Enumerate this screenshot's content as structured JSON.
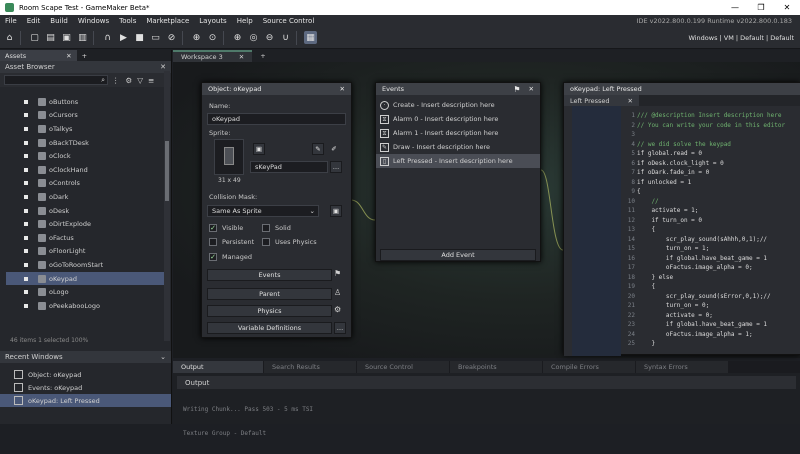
{
  "window": {
    "title": "Room Scape Test - GameMaker Beta*",
    "controls": [
      "—",
      "❐",
      "✕"
    ]
  },
  "menu": {
    "items": [
      "File",
      "Edit",
      "Build",
      "Windows",
      "Tools",
      "Marketplace",
      "Layouts",
      "Help",
      "Source Control"
    ],
    "version": "IDE v2022.800.0.199 Runtime v2022.800.0.183"
  },
  "toolbar": {
    "right": "Windows | VM | Default | Default"
  },
  "assets": {
    "tab": "Assets",
    "tab2": "+",
    "header": "Asset Browser",
    "items": [
      "oButtons",
      "oCursors",
      "oTalkys",
      "oBackTDesk",
      "oClock",
      "oClockHand",
      "oControls",
      "oDark",
      "oDesk",
      "oDirtExplode",
      "oFactus",
      "oFloorLight",
      "oGoToRoomStart",
      "oKeypad",
      "oLogo",
      "oPeekabooLogo"
    ],
    "selected": 13,
    "status": "46 items  1 selected  100%"
  },
  "recent": {
    "header": "Recent Windows",
    "items": [
      "Object: oKeypad",
      "Events: oKeypad",
      "oKeypad: Left Pressed"
    ]
  },
  "workspace": {
    "tab": "Workspace 3"
  },
  "object": {
    "title": "Object: oKeypad",
    "name_label": "Name:",
    "name_value": "oKeypad",
    "sprite_label": "Sprite:",
    "sprite_name": "sKeyPad",
    "sprite_size": "31 x 49",
    "mask_label": "Collision Mask:",
    "mask_value": "Same As Sprite",
    "visible": "Visible",
    "solid": "Solid",
    "persistent": "Persistent",
    "uses_physics": "Uses Physics",
    "managed": "Managed",
    "btn_events": "Events",
    "btn_parent": "Parent",
    "btn_physics": "Physics",
    "btn_vardefs": "Variable Definitions"
  },
  "events": {
    "title": "Events",
    "items": [
      "Create - Insert description here",
      "Alarm 0 - Insert description here",
      "Alarm 1 - Insert description here",
      "Draw - Insert description here",
      "Left Pressed - Insert description here"
    ],
    "selected": 4,
    "add": "Add Event"
  },
  "code": {
    "title": "oKeypad: Left Pressed",
    "tab": "Left Pressed",
    "lines": [
      {
        "n": "1",
        "t": "/// @description Insert description here",
        "c": "#6fb36f"
      },
      {
        "n": "2",
        "t": "// You can write your code in this editor",
        "c": "#6fb36f"
      },
      {
        "n": "3",
        "t": "",
        "c": "#ddd"
      },
      {
        "n": "4",
        "t": "// we did solve the keypad",
        "c": "#6fb36f"
      },
      {
        "n": "5",
        "t": "if global.read = 0",
        "c": "#ddd"
      },
      {
        "n": "6",
        "t": "if oDesk.clock_light = 0",
        "c": "#ddd"
      },
      {
        "n": "7",
        "t": "if oDark.fade_in = 0",
        "c": "#ddd"
      },
      {
        "n": "8",
        "t": "if unlocked = 1",
        "c": "#ddd"
      },
      {
        "n": "9",
        "t": "{",
        "c": "#ddd"
      },
      {
        "n": "10",
        "t": "    //",
        "c": "#6fb36f"
      },
      {
        "n": "11",
        "t": "    activate = 1;",
        "c": "#ddd"
      },
      {
        "n": "12",
        "t": "    if turn_on = 0",
        "c": "#ddd"
      },
      {
        "n": "13",
        "t": "    {",
        "c": "#ddd"
      },
      {
        "n": "14",
        "t": "        scr_play_sound(sAhhh,0,1);//",
        "c": "#ddd"
      },
      {
        "n": "15",
        "t": "        turn_on = 1;",
        "c": "#ddd"
      },
      {
        "n": "16",
        "t": "        if global.have_beat_game = 1",
        "c": "#ddd"
      },
      {
        "n": "17",
        "t": "        oFactus.image_alpha = 0;",
        "c": "#ddd"
      },
      {
        "n": "18",
        "t": "    } else",
        "c": "#ddd"
      },
      {
        "n": "19",
        "t": "    {",
        "c": "#ddd"
      },
      {
        "n": "20",
        "t": "        scr_play_sound(sError,0,1);//",
        "c": "#ddd"
      },
      {
        "n": "21",
        "t": "        turn_on = 0;",
        "c": "#ddd"
      },
      {
        "n": "22",
        "t": "        activate = 0;",
        "c": "#ddd"
      },
      {
        "n": "23",
        "t": "        if global.have_beat_game = 1",
        "c": "#ddd"
      },
      {
        "n": "24",
        "t": "        oFactus.image_alpha = 1;",
        "c": "#ddd"
      },
      {
        "n": "25",
        "t": "    }",
        "c": "#ddd"
      }
    ]
  },
  "output": {
    "tabs": [
      "Output",
      "Search Results",
      "Source Control",
      "Breakpoints",
      "Compile Errors",
      "Syntax Errors"
    ],
    "header": "Output",
    "lines": [
      "Writing Chunk... Pass 503 - 5 ms TSI",
      "Texture Group - Default"
    ]
  }
}
